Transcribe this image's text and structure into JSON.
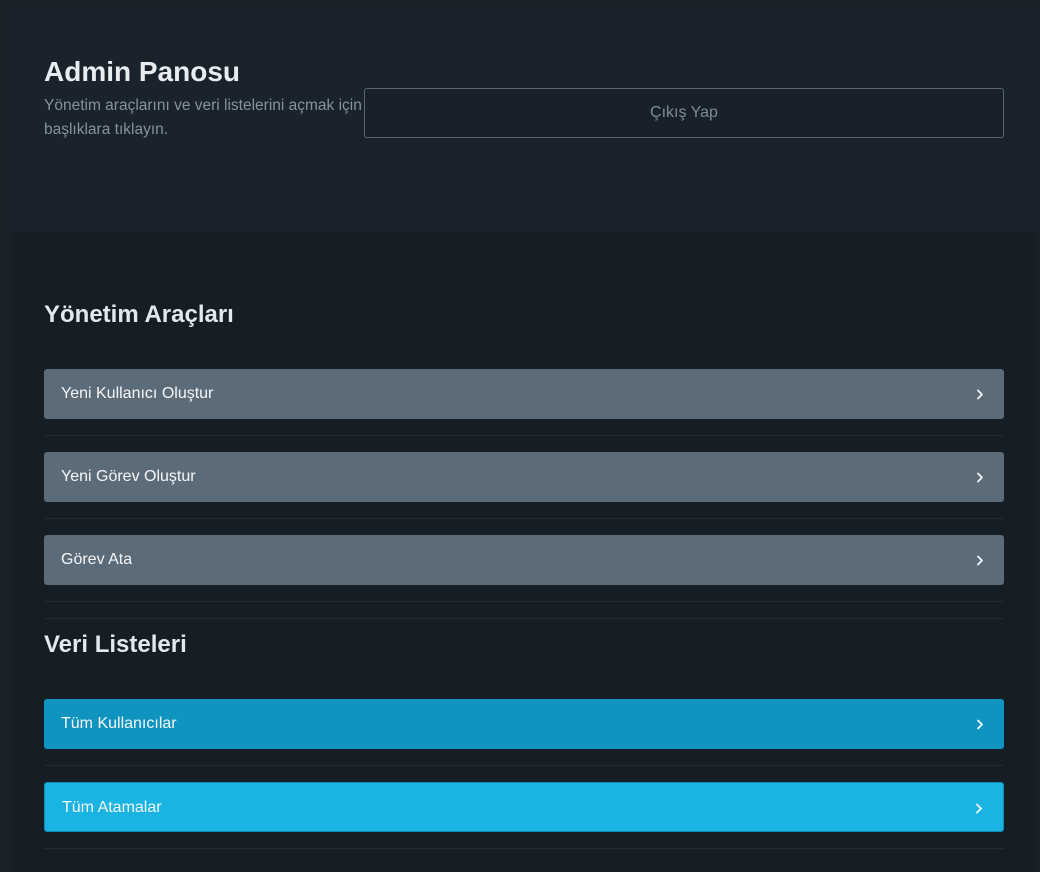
{
  "header": {
    "title": "Admin Panosu",
    "subtitle": "Yönetim araçlarını ve veri listelerini açmak için başlıklara tıklayın.",
    "logout_label": "Çıkış Yap"
  },
  "admin_tools": {
    "title": "Yönetim Araçları",
    "items": [
      {
        "label": "Yeni Kullanıcı Oluştur",
        "icon": "chevron-right-icon"
      },
      {
        "label": "Yeni Görev Oluştur",
        "icon": "chevron-right-icon"
      },
      {
        "label": "Görev Ata",
        "icon": "chevron-right-icon"
      }
    ]
  },
  "data_lists": {
    "title": "Veri Listeleri",
    "items": [
      {
        "label": "Tüm Kullanıcılar",
        "icon": "chevron-right-icon"
      },
      {
        "label": "Tüm Atamalar",
        "icon": "chevron-right-icon"
      }
    ]
  },
  "colors": {
    "page_bg": "#151d25",
    "header_bg": "#1a222b",
    "admin_row": "#5c6b78",
    "users_row": "#0f93bf",
    "assignments_row": "#19b4e2"
  }
}
